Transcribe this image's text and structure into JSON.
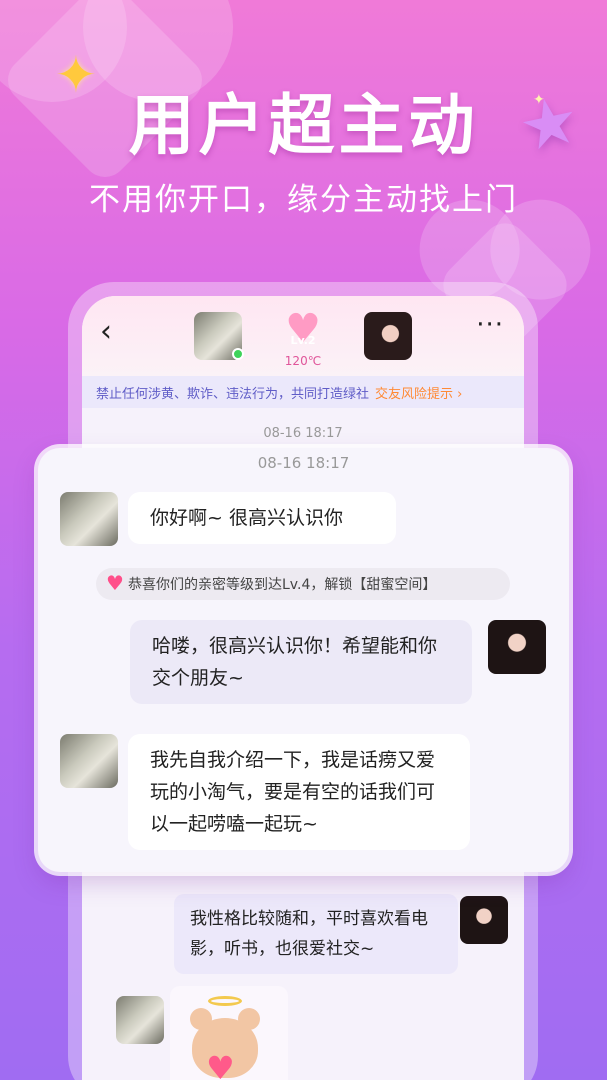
{
  "banner": {
    "headline": "用户超主动",
    "subline": "不用你开口，缘分主动找上门"
  },
  "chat_header": {
    "back_icon": "‹",
    "level": "Lv.2",
    "temperature": "120℃",
    "more_icon": "···"
  },
  "warning": {
    "text": "禁止任何涉黄、欺诈、违法行为，共同打造绿社",
    "link": "交友风险提示 ›"
  },
  "phone_timestamp": "08-16 18:17",
  "card": {
    "timestamp": "08-16 18:17",
    "messages": [
      {
        "side": "left",
        "text": "你好啊~ 很高兴认识你"
      },
      {
        "side": "system",
        "text": "恭喜你们的亲密等级到达Lv.4，解锁【甜蜜空间】"
      },
      {
        "side": "right",
        "text": "哈喽，很高兴认识你！希望能和你交个朋友~"
      },
      {
        "side": "left",
        "text": "我先自我介绍一下，我是话痨又爱玩的小淘气，要是有空的话我们可以一起唠嗑一起玩~"
      }
    ]
  },
  "lower_messages": [
    {
      "side": "right",
      "text": "我性格比较随和，平时喜欢看电影，听书，也很爱社交~"
    }
  ],
  "colors": {
    "bg_top": "#f07ad8",
    "bg_bottom": "#a06cf2",
    "warning_link": "#ff8a36",
    "warning_text": "#5f5cc7"
  }
}
